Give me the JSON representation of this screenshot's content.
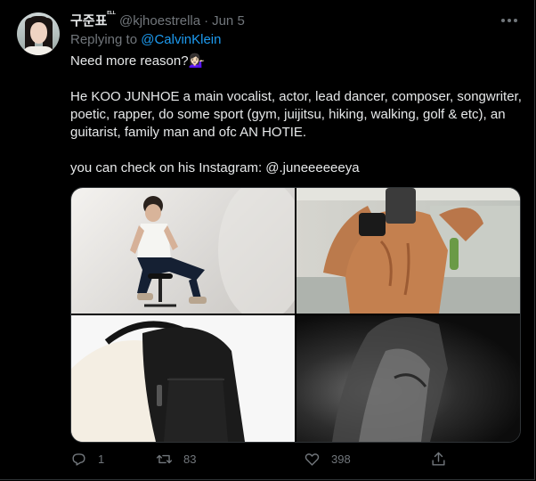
{
  "tweet": {
    "author": {
      "display_name": "구준표",
      "name_suffix": "ᴱᴸᴸ",
      "handle": "@kjhoestrella",
      "separator": "·",
      "date": "Jun 5"
    },
    "replying_prefix": "Replying to",
    "replying_to": "@CalvinKlein",
    "lines": {
      "line1": "Need more reason?💁🏻‍♀️",
      "line2": "He KOO JUNHOE a main vocalist, actor, lead dancer, composer, songwriter, poetic, rapper, do some sport (gym, juijitsu, hiking, walking, golf & etc), an guitarist, family man and ofc AN HOTIE.",
      "line3": "you can check on his Instagram: @.juneeeeeeya"
    },
    "stats": {
      "replies": "1",
      "retweets": "83",
      "likes": "398"
    }
  },
  "icons": {
    "more": "more-horizontal-icon",
    "reply": "reply-icon",
    "retweet": "retweet-icon",
    "like": "heart-icon",
    "share": "share-icon"
  },
  "colors": {
    "background": "#000000",
    "text": "#e7e9ea",
    "muted": "#71767b",
    "link": "#1d9bf0",
    "border": "#2f3336"
  }
}
